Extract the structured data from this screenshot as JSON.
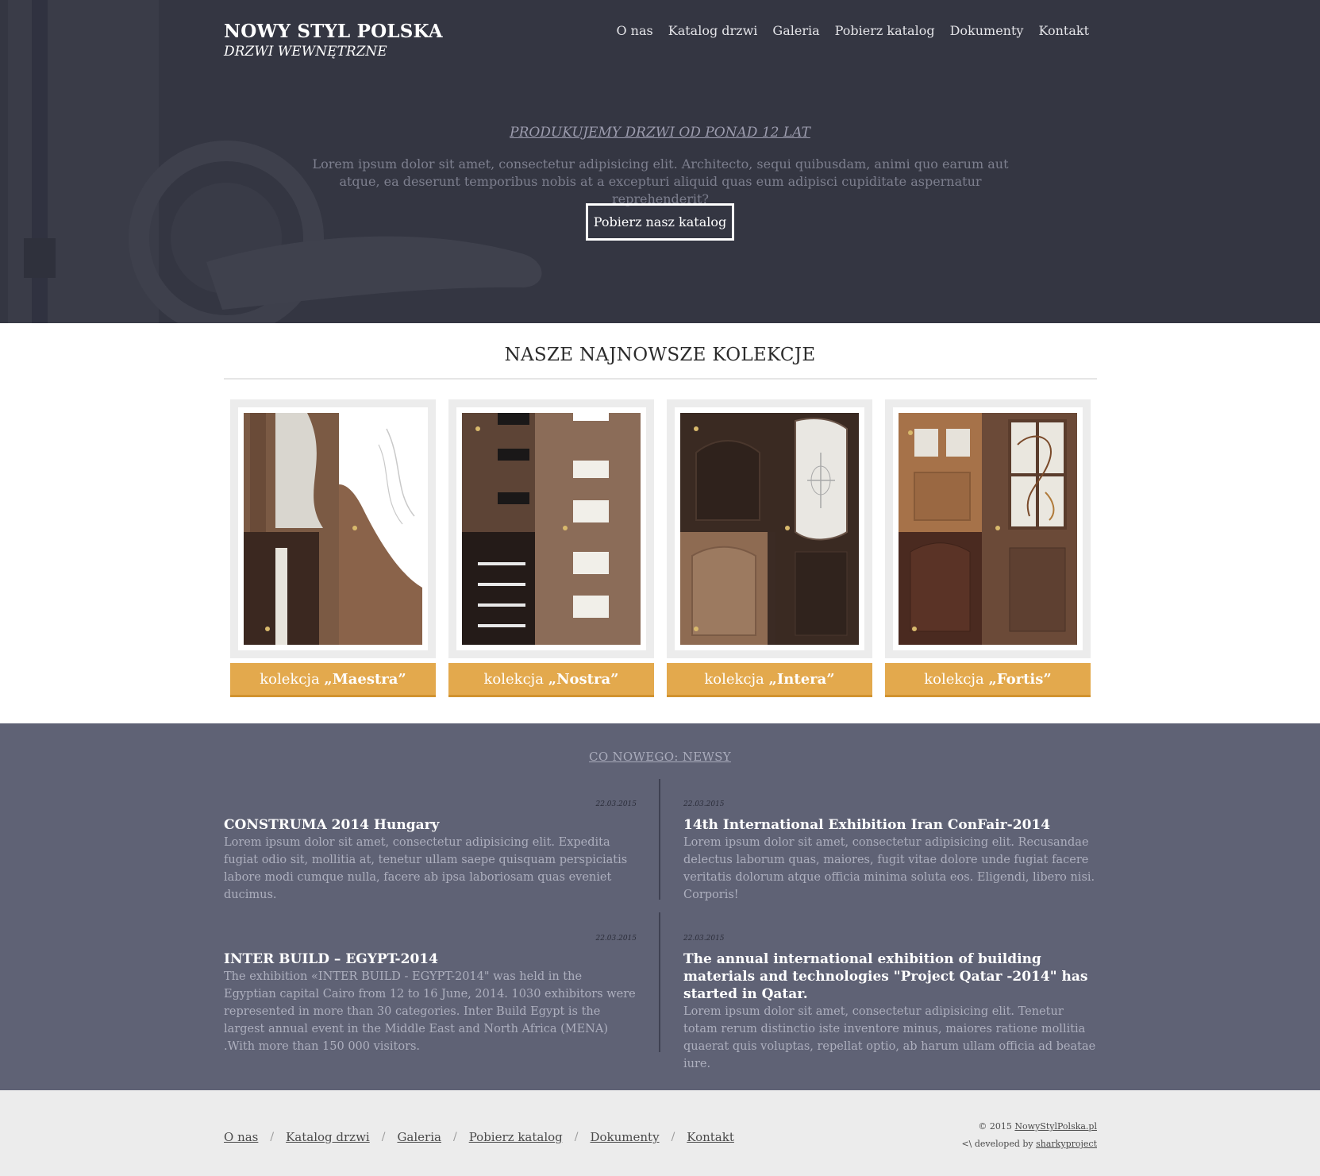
{
  "header": {
    "brand_name": "NOWY STYL POLSKA",
    "brand_sub": "DRZWI WEWNĘTRZNE",
    "nav": [
      "O nas",
      "Katalog drzwi",
      "Galeria",
      "Pobierz katalog",
      "Dokumenty",
      "Kontakt"
    ]
  },
  "hero": {
    "tagline": "PRODUKUJEMY DRZWI OD PONAD 12 LAT",
    "text": "Lorem ipsum dolor sit amet, consectetur adipisicing elit. Architecto, sequi quibusdam, animi quo earum aut atque, ea deserunt temporibus nobis at a excepturi aliquid quas eum adipisci cupiditate aspernatur reprehenderit?",
    "button": "Pobierz nasz katalog"
  },
  "collections": {
    "title": "NASZE NAJNOWSZE KOLEKCJE",
    "prefix": "kolekcja",
    "items": [
      {
        "name": "„Maestra”"
      },
      {
        "name": "„Nostra”"
      },
      {
        "name": "„Intera”"
      },
      {
        "name": "„Fortis”"
      }
    ]
  },
  "news": {
    "title": "CO NOWEGO: NEWSY",
    "items": [
      {
        "date": "22.03.2015",
        "title": "CONSTRUMA 2014 Hungary",
        "body": "Lorem ipsum dolor sit amet, consectetur adipisicing elit. Expedita fugiat odio sit, mollitia at, tenetur ullam saepe quisquam perspiciatis labore modi cumque nulla, facere ab ipsa laboriosam quas eveniet ducimus."
      },
      {
        "date": "22.03.2015",
        "title": "14th International Exhibition Iran ConFair-2014",
        "body": "Lorem ipsum dolor sit amet, consectetur adipisicing elit. Recusandae delectus laborum quas, maiores, fugit vitae dolore unde fugiat facere veritatis dolorum atque officia minima soluta eos. Eligendi, libero nisi. Corporis!"
      },
      {
        "date": "22.03.2015",
        "title": "INTER BUILD – EGYPT-2014",
        "body": "The exhibition «INTER BUILD - EGYPT-2014\" was held in the Egyptian capital Cairo from 12 to 16 June, 2014. 1030 exhibitors were represented in more than 30 categories. Inter Build Egypt is the largest annual event in the Middle East and North Africa (MENA) .With more than 150 000 visitors."
      },
      {
        "date": "22.03.2015",
        "title": "The annual international exhibition of building materials and technologies \"Project Qatar -2014\" has started in Qatar.",
        "body": "Lorem ipsum dolor sit amet, consectetur adipisicing elit. Tenetur totam rerum distinctio iste inventore minus, maiores ratione mollitia quaerat quis voluptas, repellat optio, ab harum ullam officia ad beatae iure."
      }
    ]
  },
  "footer": {
    "nav": [
      "O nas",
      "Katalog drzwi",
      "Galeria",
      "Pobierz katalog",
      "Dokumenty",
      "Kontakt"
    ],
    "copyright_prefix": "© 2015",
    "copyright_site": "NowyStylPolska.pl",
    "dev_prefix": "<\\ developed by",
    "dev_name": "sharkyproject"
  },
  "colors": {
    "hero_bg": "#343642",
    "accent": "#e3a94d",
    "news_bg": "#5f6275",
    "footer_bg": "#ececec"
  }
}
